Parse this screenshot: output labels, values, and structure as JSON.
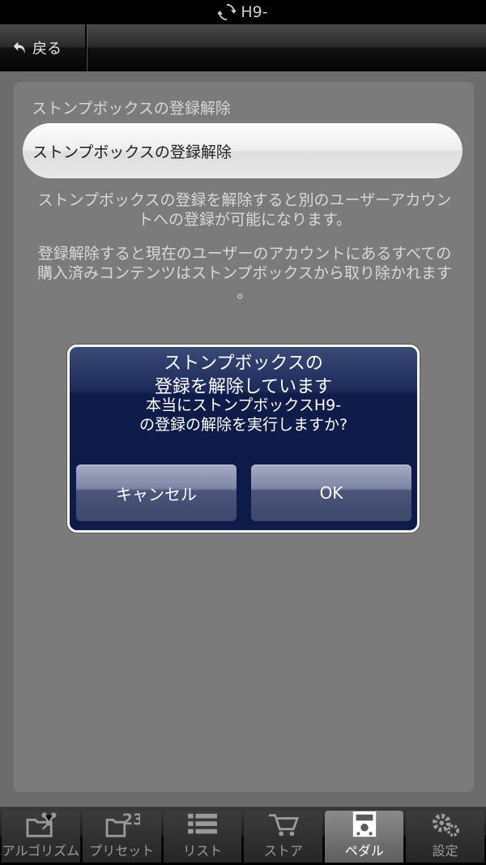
{
  "status_bar": {
    "title": "H9-"
  },
  "nav": {
    "back_label": "戻る"
  },
  "content": {
    "section_title": "ストンプボックスの登録解除",
    "unregister_button": "ストンプボックスの登録解除",
    "desc_line1": "ストンプボックスの登録を解除すると別のユーザーアカウン",
    "desc_line2": "トへの登録が可能になります。",
    "desc2_line1": "登録解除すると現在のユーザーのアカウントにあるすべての",
    "desc2_line2": "購入済みコンテンツはストンプボックスから取り除かれます",
    "desc2_line3": "。"
  },
  "dialog": {
    "title_line1": "ストンプボックスの",
    "title_line2": "登録を解除しています",
    "message_line1": "本当にストンプボックスH9-",
    "message_line2": "の登録の解除を実行しますか?",
    "cancel_label": "キャンセル",
    "ok_label": "OK"
  },
  "tabs": [
    {
      "label": "アルゴリズム",
      "icon": "algorithm-icon",
      "active": false
    },
    {
      "label": "プリセット",
      "icon": "preset-icon",
      "active": false
    },
    {
      "label": "リスト",
      "icon": "list-icon",
      "active": false
    },
    {
      "label": "ストア",
      "icon": "cart-icon",
      "active": false
    },
    {
      "label": "ペダル",
      "icon": "pedal-icon",
      "active": true
    },
    {
      "label": "設定",
      "icon": "gear-icon",
      "active": false
    }
  ],
  "colors": {
    "background": "#6c6c6c",
    "card": "#7b7b7b",
    "dialog": "#0e1a48",
    "dialog_border": "#ffffff"
  }
}
